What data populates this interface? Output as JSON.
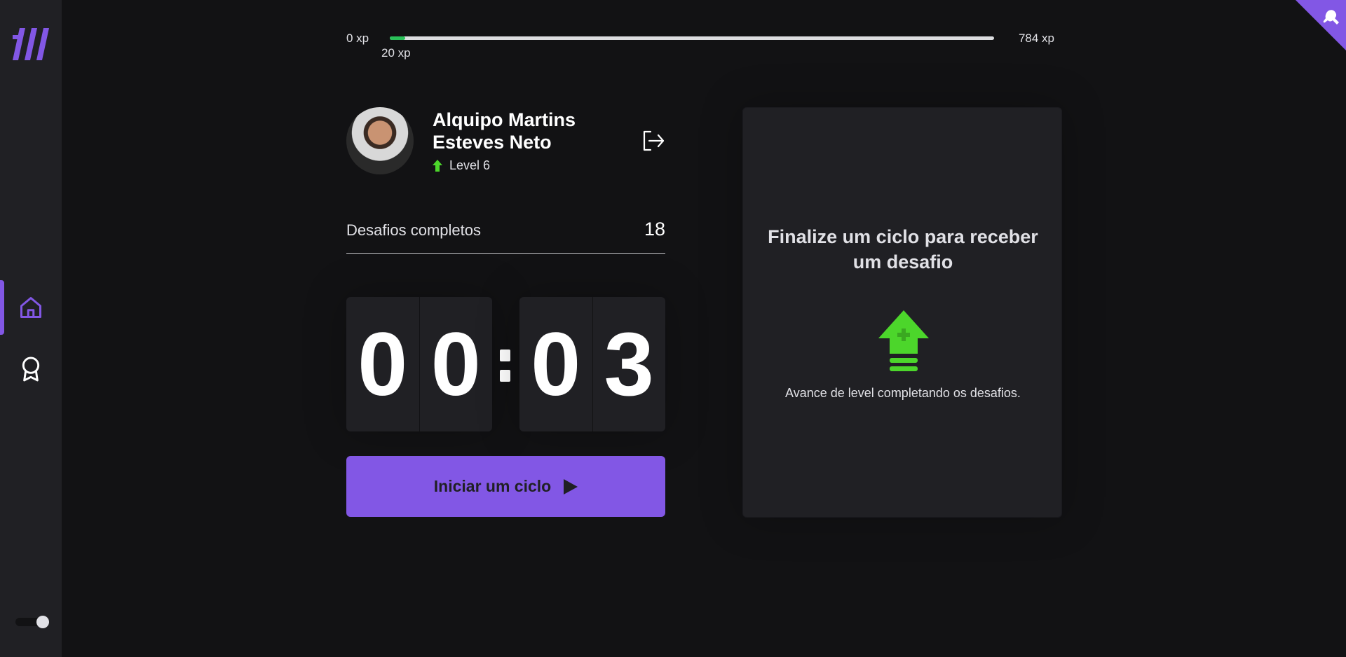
{
  "xp": {
    "start_label": "0 xp",
    "current_label": "20 xp",
    "end_label": "784 xp",
    "progress_fraction": 0.026
  },
  "profile": {
    "name": "Alquipo Martins Esteves Neto",
    "level_label": "Level 6"
  },
  "stats": {
    "completed_label": "Desafios completos",
    "completed_count": "18"
  },
  "countdown": {
    "minute_left": "0",
    "minute_right": "0",
    "second_left": "0",
    "second_right": "3"
  },
  "start_button": {
    "label": "Iniciar um ciclo"
  },
  "challenge_box": {
    "title": "Finalize um ciclo para receber um desafio",
    "hint": "Avance de level completando os desafios."
  },
  "colors": {
    "background": "#121214",
    "sidebar": "#202024",
    "accent": "#8257e5",
    "level_green": "#4cd62b",
    "xp_green": "#2ac159"
  },
  "icons": {
    "logo": "moveit-logo-icon",
    "home": "home-icon",
    "award": "award-icon",
    "logout": "logout-icon",
    "level": "level-up-arrow-icon",
    "play": "play-icon",
    "corner": "github-corner-icon"
  }
}
